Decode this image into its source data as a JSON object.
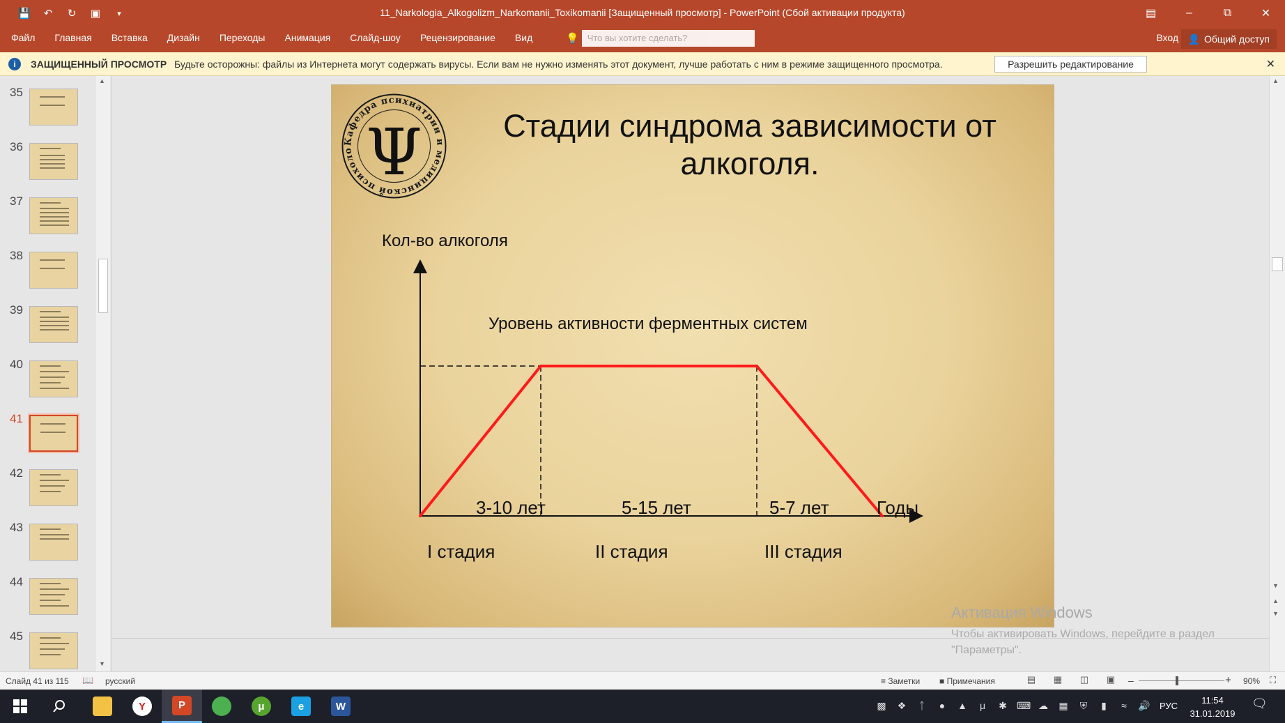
{
  "window": {
    "title": "11_Narkologia_Alkogolizm_Narkomanii_Toxikomanii [Защищенный просмотр] - PowerPoint (Сбой активации продукта)"
  },
  "ribbon": {
    "tabs": [
      "Файл",
      "Главная",
      "Вставка",
      "Дизайн",
      "Переходы",
      "Анимация",
      "Слайд-шоу",
      "Рецензирование",
      "Вид"
    ],
    "tell_me_placeholder": "Что вы хотите сделать?",
    "sign_in": "Вход",
    "share": "Общий доступ"
  },
  "protected_view": {
    "title": "ЗАЩИЩЕННЫЙ ПРОСМОТР",
    "message": "Будьте осторожны: файлы из Интернета могут содержать вирусы. Если вам не нужно изменять этот документ, лучше работать с ним в режиме защищенного просмотра.",
    "enable_button": "Разрешить редактирование"
  },
  "thumbnails": [
    {
      "number": "35",
      "active": false
    },
    {
      "number": "36",
      "active": false
    },
    {
      "number": "37",
      "active": false
    },
    {
      "number": "38",
      "active": false
    },
    {
      "number": "39",
      "active": false
    },
    {
      "number": "40",
      "active": false
    },
    {
      "number": "41",
      "active": true
    },
    {
      "number": "42",
      "active": false
    },
    {
      "number": "43",
      "active": false
    },
    {
      "number": "44",
      "active": false
    },
    {
      "number": "45",
      "active": false
    }
  ],
  "slide": {
    "title": "Стадии синдрома зависимости от алкоголя."
  },
  "chart_data": {
    "type": "line",
    "ylabel": "Кол-во алкоголя",
    "xlabel": "Годы",
    "annotation": "Уровень активности ферментных систем",
    "segments": [
      "3-10 лет",
      "5-15 лет",
      "5-7 лет"
    ],
    "stages": [
      "I стадия",
      "II стадия",
      "III стадия"
    ],
    "series": [
      {
        "points": [
          [
            0,
            0
          ],
          [
            1,
            1
          ],
          [
            2,
            1
          ],
          [
            3,
            0
          ]
        ]
      }
    ],
    "line_color": "#ff1a1a"
  },
  "watermark": {
    "line1": "Активация Windows",
    "line2": "Чтобы активировать Windows, перейдите в раздел",
    "line3": "\"Параметры\"."
  },
  "statusbar": {
    "slide_counter": "Слайд 41 из 115",
    "language": "русский",
    "notes": "Заметки",
    "comments": "Примечания",
    "zoom": "90%"
  },
  "taskbar": {
    "apps": [
      {
        "name": "file-explorer",
        "label": "",
        "color": "#f3c244"
      },
      {
        "name": "yandex-browser",
        "label": "Y",
        "color": "#ffffff"
      },
      {
        "name": "powerpoint",
        "label": "P",
        "color": "#d24726",
        "active": true
      },
      {
        "name": "chrome",
        "label": "",
        "color": "#4caf50"
      },
      {
        "name": "utorrent",
        "label": "μ",
        "color": "#57a52f"
      },
      {
        "name": "internet-explorer",
        "label": "e",
        "color": "#1ba1e2"
      },
      {
        "name": "word",
        "label": "W",
        "color": "#2b579a"
      }
    ],
    "language": "РУС",
    "time": "11:54",
    "date": "31.01.2019"
  }
}
